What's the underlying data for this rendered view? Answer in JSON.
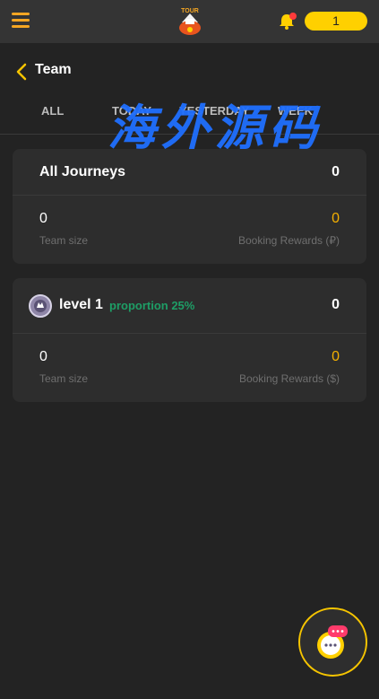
{
  "header": {
    "balance": "1",
    "page_title": "Team"
  },
  "tabs": [
    {
      "label": "ALL"
    },
    {
      "label": "TODAY"
    },
    {
      "label": "YESTERDAY"
    },
    {
      "label": "WEEK"
    }
  ],
  "watermark": "海外源码",
  "journeys_card": {
    "title": "All Journeys",
    "total": "0",
    "team_size_value": "0",
    "team_size_label": "Team size",
    "rewards_value": "0",
    "rewards_label": "Booking Rewards (₽)"
  },
  "level_card": {
    "title": "level 1",
    "proportion": "proportion 25%",
    "total": "0",
    "team_size_value": "0",
    "team_size_label": "Team size",
    "rewards_value": "0",
    "rewards_label": "Booking Rewards ($)"
  },
  "colors": {
    "accent": "#f5a623",
    "gold": "#ffd000",
    "reward": "#f5b000",
    "proportion": "#1e9e66",
    "watermark": "#1f6fff"
  },
  "icons": [
    "hamburger-icon",
    "tour-logo",
    "bell-icon",
    "back-chevron-icon",
    "level-badge-icon",
    "chat-icon"
  ]
}
